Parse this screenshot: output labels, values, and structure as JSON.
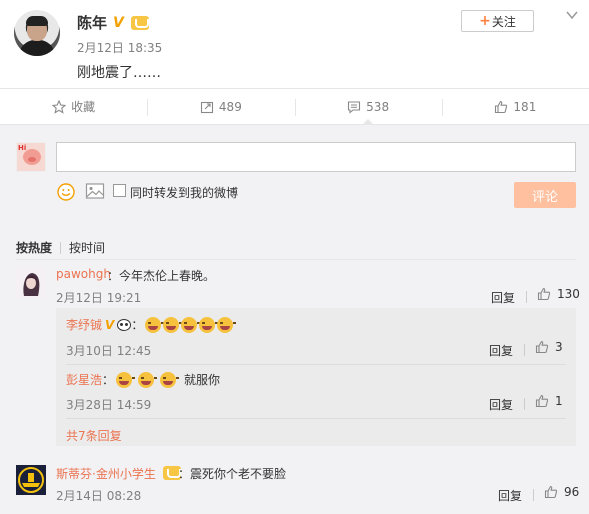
{
  "post": {
    "author": "陈年",
    "time": "2月12日 18:35",
    "text": "刚地震了……",
    "follow_label": "关注"
  },
  "actions": [
    {
      "label": "收藏",
      "icon": "star-icon"
    },
    {
      "label": "489",
      "icon": "forward-icon"
    },
    {
      "label": "538",
      "icon": "comment-icon"
    },
    {
      "label": "181",
      "icon": "thumb-up-icon"
    }
  ],
  "composer": {
    "placeholder": "",
    "forward_label": "同时转发到我的微博",
    "submit_label": "评论"
  },
  "sort": {
    "hot": "按热度",
    "time": "按时间"
  },
  "comments": [
    {
      "name": "pawohgh",
      "text": "：今年杰伦上春晚。",
      "time": "2月12日 19:21",
      "reply": "回复",
      "likes": "130"
    },
    {
      "name": "斯蒂芬·金州小学生",
      "text": "：震死你个老不要脸",
      "time": "2月14日 08:28",
      "reply": "回复",
      "likes": "96"
    }
  ],
  "replies": [
    {
      "name": "李纾铖",
      "text": "：",
      "time": "3月10日 12:45",
      "reply": "回复",
      "likes": "3"
    },
    {
      "name": "彭星浩",
      "text": "：",
      "after_text": "就服你",
      "time": "3月28日 14:59",
      "reply": "回复",
      "likes": "1"
    }
  ],
  "more_replies": "共7条回复",
  "colors": {
    "accent": "#eb7350",
    "submit": "#ffc09f",
    "verified": "#f2a100"
  }
}
